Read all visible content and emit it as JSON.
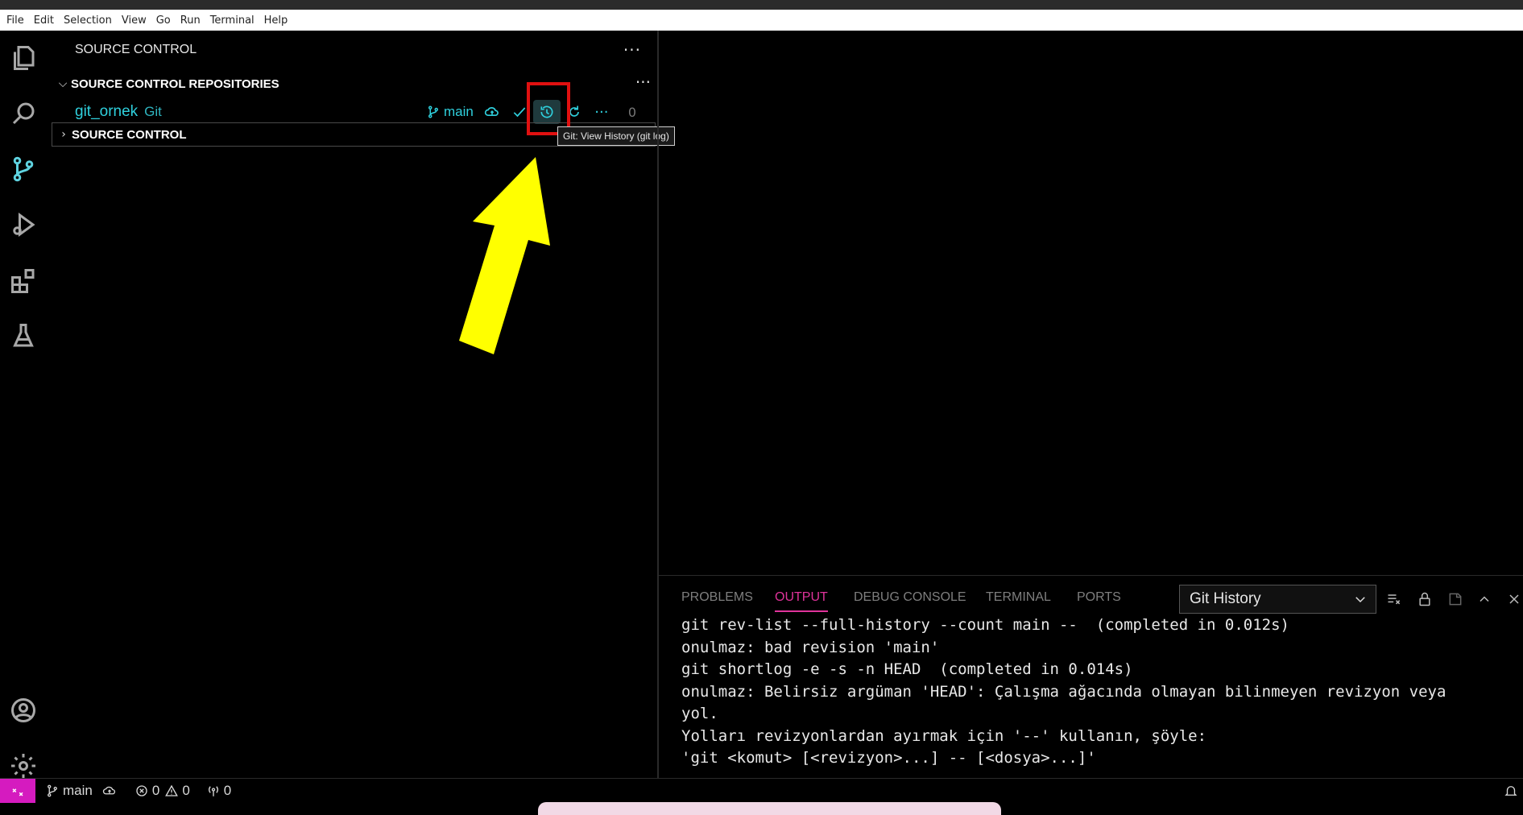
{
  "menubar": {
    "items": [
      "File",
      "Edit",
      "Selection",
      "View",
      "Go",
      "Run",
      "Terminal",
      "Help"
    ]
  },
  "activitybar": {
    "icons": [
      "explorer-icon",
      "search-icon",
      "source-control-icon",
      "run-debug-icon",
      "extensions-icon",
      "testing-icon",
      "account-icon",
      "settings-gear-icon"
    ]
  },
  "sidebar": {
    "title": "SOURCE CONTROL",
    "more": "···",
    "repos_section": {
      "label": "SOURCE CONTROL REPOSITORIES",
      "more": "···",
      "repo": {
        "name": "git_ornek",
        "kind": "Git",
        "branch": "main",
        "more": "···",
        "count": "0"
      }
    },
    "sc_section": {
      "label": "SOURCE CONTROL"
    },
    "tooltip": "Git: View History (git log)"
  },
  "panel": {
    "tabs": [
      "PROBLEMS",
      "OUTPUT",
      "DEBUG CONSOLE",
      "TERMINAL",
      "PORTS"
    ],
    "active_tab": "OUTPUT",
    "channel": "Git History",
    "output_lines": [
      "git rev-list --full-history --count main --  (completed in 0.012s)",
      "onulmaz: bad revision 'main'",
      "",
      "git shortlog -e -s -n HEAD  (completed in 0.014s)",
      "onulmaz: Belirsiz argüman 'HEAD': Çalışma ağacında olmayan bilinmeyen revizyon veya",
      "yol.",
      "Yolları revizyonlardan ayırmak için '--' kullanın, şöyle:",
      "'git <komut> [<revizyon>...] -- [<dosya>...]'"
    ]
  },
  "statusbar": {
    "branch": "main",
    "errors": "0",
    "warnings": "0",
    "ports": "0"
  },
  "colors": {
    "accent": "#2fd0dd",
    "output_tab": "#e0339b",
    "remote": "#d51bbf",
    "highlight": "#e01010",
    "arrow": "#ffff00"
  }
}
